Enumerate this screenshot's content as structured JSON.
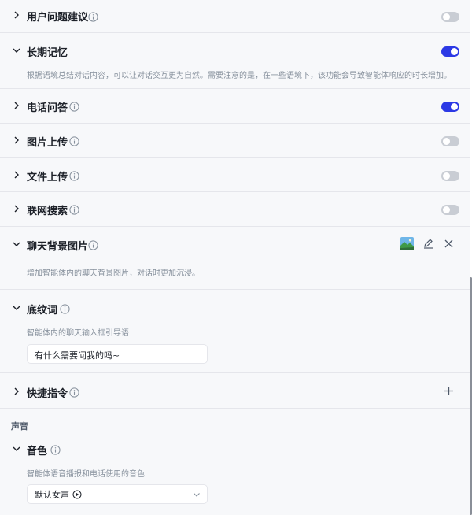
{
  "colors": {
    "accent": "#2c39e5",
    "toggle_off": "#c9cdd4",
    "background": "#f7f8fa",
    "divider": "#e5e6eb"
  },
  "rows": {
    "suggest": {
      "title": "用户问题建议",
      "enabled": false
    },
    "memory": {
      "title": "长期记忆",
      "enabled": true,
      "desc": "根据语境总结对话内容，可以让对话交互更为自然。需要注意的是，在一些语境下，该功能会导致智能体响应的时长增加。"
    },
    "phone": {
      "title": "电话问答",
      "enabled": true
    },
    "image_upload": {
      "title": "图片上传",
      "enabled": false
    },
    "file_upload": {
      "title": "文件上传",
      "enabled": false
    },
    "web_search": {
      "title": "联网搜索",
      "enabled": false
    },
    "chat_bg": {
      "title": "聊天背景图片",
      "desc": "增加智能体内的聊天背景图片，对话时更加沉浸。",
      "icons": [
        "landscape-thumbnail-icon",
        "edit-icon",
        "close-icon"
      ]
    },
    "placeholder": {
      "title": "底纹词",
      "desc": "智能体内的聊天输入框引导语",
      "value": "有什么需要问我的吗~"
    },
    "shortcut": {
      "title": "快捷指令",
      "icons": [
        "plus-icon"
      ]
    }
  },
  "voice_section": {
    "label": "声音",
    "timbre": {
      "title": "音色",
      "desc": "智能体语音播报和电话使用的音色",
      "selected": "默认女声"
    }
  }
}
